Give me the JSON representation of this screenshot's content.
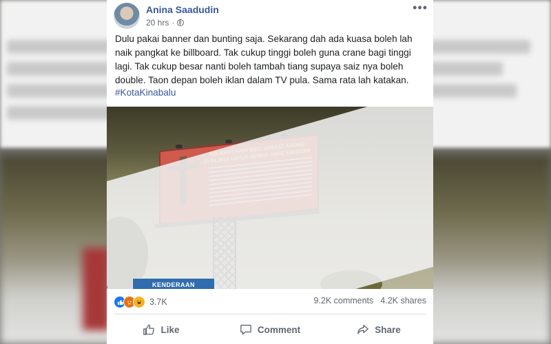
{
  "post": {
    "author": "Anina Saadudin",
    "time": "20 hrs",
    "privacy_icon": "globe-icon",
    "text": "Dulu pakai banner dan bunting saja. Sekarang dah ada kuasa boleh lah naik pangkat ke billboard. Tak cukup tinggi boleh guna crane bagi tinggi lagi. Tak cukup besar nanti boleh tambah tiang supaya saiz nya boleh double. Taon depan boleh iklan dalam TV pula. Sama rata lah katakan.",
    "hashtag": "#KotaKinabalu"
  },
  "photo": {
    "billboard_title": "SELAMAT HARI SUCI JUMAAT AGUNG 19.04.2019 UNTUK SEMUA UMAT KRISTIAN",
    "road_sign": "KENDERAAN"
  },
  "stats": {
    "reactions": [
      "like",
      "angry",
      "haha"
    ],
    "reaction_count": "3.7K",
    "comments": "9.2K comments",
    "shares": "4.2K shares"
  },
  "actions": {
    "like": "Like",
    "comment": "Comment",
    "share": "Share"
  },
  "colors": {
    "link": "#385898",
    "secondary_text": "#606770",
    "like_reaction": "#1877f2"
  }
}
